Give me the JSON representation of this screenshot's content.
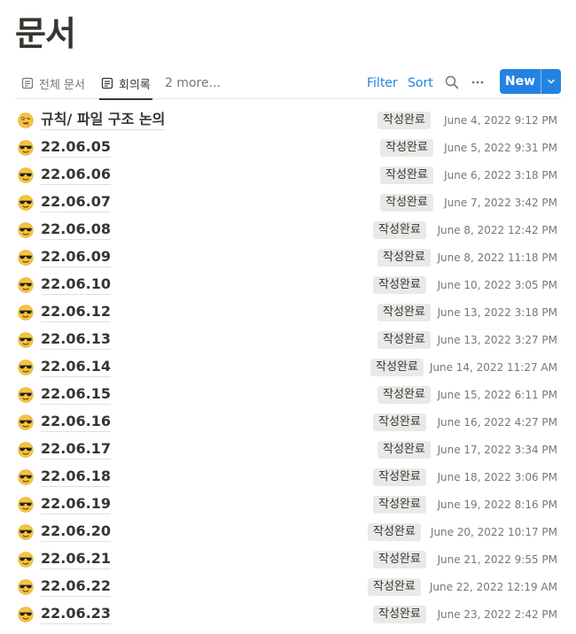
{
  "page": {
    "title": "문서"
  },
  "views": {
    "tabs": [
      {
        "label": "전체 문서",
        "icon": "document-icon"
      },
      {
        "label": "회의록",
        "icon": "document-icon"
      }
    ],
    "more_label": "2 more..."
  },
  "toolbar": {
    "filter_label": "Filter",
    "sort_label": "Sort",
    "search_icon": "search-icon",
    "more_icon": "more-icon",
    "new_label": "New",
    "accent": "#2383e2"
  },
  "rows": [
    {
      "emoji": "drooling-face",
      "title": "규칙/ 파일 구조 논의",
      "status": "작성완료",
      "date": "June 4, 2022 9:12 PM"
    },
    {
      "emoji": "sunglasses-face",
      "title": "22.06.05",
      "status": "작성완료",
      "date": "June 5, 2022 9:31 PM"
    },
    {
      "emoji": "sunglasses-face",
      "title": "22.06.06",
      "status": "작성완료",
      "date": "June 6, 2022 3:18 PM"
    },
    {
      "emoji": "sunglasses-face",
      "title": "22.06.07",
      "status": "작성완료",
      "date": "June 7, 2022 3:42 PM"
    },
    {
      "emoji": "sunglasses-face",
      "title": "22.06.08",
      "status": "작성완료",
      "date": "June 8, 2022 12:42 PM"
    },
    {
      "emoji": "sunglasses-face",
      "title": "22.06.09",
      "status": "작성완료",
      "date": "June 8, 2022 11:18 PM"
    },
    {
      "emoji": "sunglasses-face",
      "title": "22.06.10",
      "status": "작성완료",
      "date": "June 10, 2022 3:05 PM"
    },
    {
      "emoji": "sunglasses-face",
      "title": "22.06.12",
      "status": "작성완료",
      "date": "June 13, 2022 3:18 PM"
    },
    {
      "emoji": "sunglasses-face",
      "title": "22.06.13",
      "status": "작성완료",
      "date": "June 13, 2022 3:27 PM"
    },
    {
      "emoji": "sunglasses-face",
      "title": "22.06.14",
      "status": "작성완료",
      "date": "June 14, 2022 11:27 AM"
    },
    {
      "emoji": "sunglasses-face",
      "title": "22.06.15",
      "status": "작성완료",
      "date": "June 15, 2022 6:11 PM"
    },
    {
      "emoji": "sunglasses-face",
      "title": "22.06.16",
      "status": "작성완료",
      "date": "June 16, 2022 4:27 PM"
    },
    {
      "emoji": "sunglasses-face",
      "title": "22.06.17",
      "status": "작성완료",
      "date": "June 17, 2022 3:34 PM"
    },
    {
      "emoji": "sunglasses-face",
      "title": "22.06.18",
      "status": "작성완료",
      "date": "June 18, 2022 3:06 PM"
    },
    {
      "emoji": "sunglasses-face",
      "title": "22.06.19",
      "status": "작성완료",
      "date": "June 19, 2022 8:16 PM"
    },
    {
      "emoji": "sunglasses-face",
      "title": "22.06.20",
      "status": "작성완료",
      "date": "June 20, 2022 10:17 PM"
    },
    {
      "emoji": "sunglasses-face",
      "title": "22.06.21",
      "status": "작성완료",
      "date": "June 21, 2022 9:55 PM"
    },
    {
      "emoji": "sunglasses-face",
      "title": "22.06.22",
      "status": "작성완료",
      "date": "June 22, 2022 12:19 AM"
    },
    {
      "emoji": "sunglasses-face",
      "title": "22.06.23",
      "status": "작성완료",
      "date": "June 23, 2022 2:42 PM"
    }
  ]
}
